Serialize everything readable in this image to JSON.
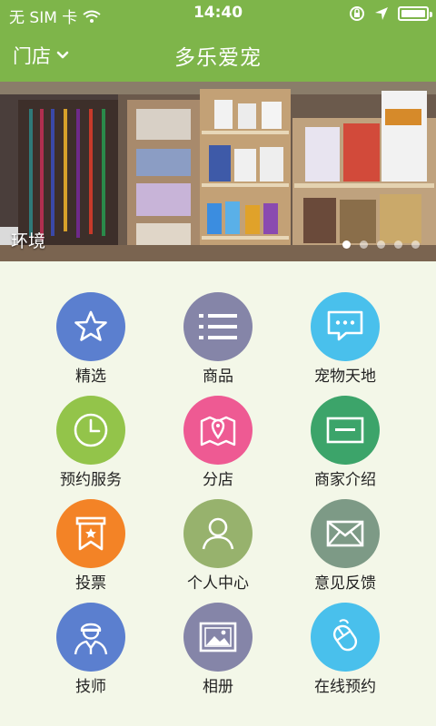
{
  "status_bar": {
    "carrier": "无 SIM 卡",
    "time": "14:40"
  },
  "nav": {
    "store_label": "门店",
    "title": "多乐爱宠"
  },
  "banner": {
    "caption": "环境",
    "dot_count": 5,
    "active_dot": 1
  },
  "menu": {
    "items": [
      {
        "label": "精选",
        "icon": "star-icon",
        "color": "#5b7fcf"
      },
      {
        "label": "商品",
        "icon": "list-icon",
        "color": "#8585a8"
      },
      {
        "label": "宠物天地",
        "icon": "chat-icon",
        "color": "#49c0ec"
      },
      {
        "label": "预约服务",
        "icon": "clock-icon",
        "color": "#93c44a"
      },
      {
        "label": "分店",
        "icon": "map-pin-icon",
        "color": "#ee5a93"
      },
      {
        "label": "商家介绍",
        "icon": "card-icon",
        "color": "#3ca46a"
      },
      {
        "label": "投票",
        "icon": "vote-badge-icon",
        "color": "#f38326"
      },
      {
        "label": "个人中心",
        "icon": "user-icon",
        "color": "#97b26d"
      },
      {
        "label": "意见反馈",
        "icon": "mail-icon",
        "color": "#7d9a86"
      },
      {
        "label": "技师",
        "icon": "technician-icon",
        "color": "#5b7fcf"
      },
      {
        "label": "相册",
        "icon": "picture-icon",
        "color": "#8585a8"
      },
      {
        "label": "在线预约",
        "icon": "mouse-icon",
        "color": "#49c0ec"
      }
    ]
  }
}
